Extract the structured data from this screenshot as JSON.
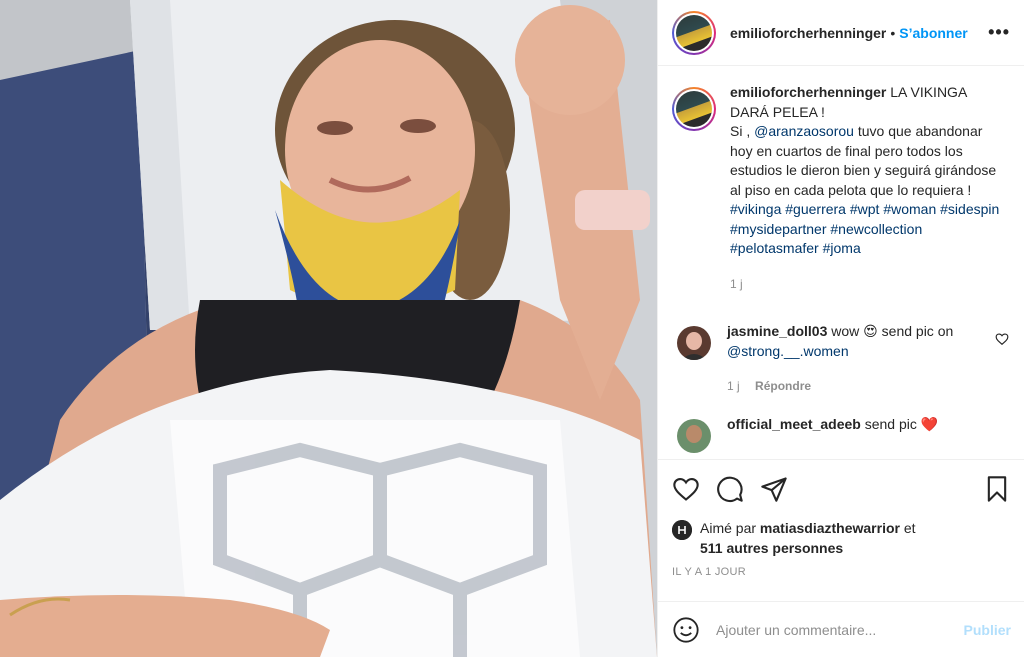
{
  "post": {
    "username": "emilioforcherhenninger",
    "follow_label": "S’abonner",
    "separator": "•",
    "more_label": "•••",
    "photo_alt": "Photo de la publication"
  },
  "caption": {
    "username": "emilioforcherhenninger",
    "text_intro": "LA VIKINGA DARÁ PELEA !",
    "line2_pre": "Si , ",
    "mention": "@aranzaosorou",
    "line2_post": " tuvo que abandonar hoy en cuartos de final pero todos los estudios le dieron bien y seguirá girándose al piso en cada pelota que lo requiera !",
    "hashtags": [
      "#vikinga",
      "#guerrera",
      "#wpt",
      "#woman",
      "#sidespin",
      "#mysidepartner",
      "#newcollection",
      "#pelotasmafer",
      "#joma"
    ],
    "time": "1 j"
  },
  "comments": [
    {
      "username": "jasmine_doll03",
      "text": "wow 😍 send pic on ",
      "mention": "@strong.__.women",
      "time": "1 j",
      "reply_label": "Répondre"
    },
    {
      "username": "official_meet_adeeb",
      "text": "send pic ❤️"
    }
  ],
  "likes": {
    "prefix": "Aimé par ",
    "user": "matiasdiazthewarrior",
    "suffix": " et",
    "others": "511 autres personnes"
  },
  "timestamp": "IL Y A 1 JOUR",
  "add_comment": {
    "placeholder": "Ajouter un commentaire...",
    "publish_label": "Publier"
  },
  "colors": {
    "accent": "#0095f6",
    "link": "#00376b",
    "muted": "#8e8e8e",
    "publish_disabled": "#b2dffc"
  }
}
